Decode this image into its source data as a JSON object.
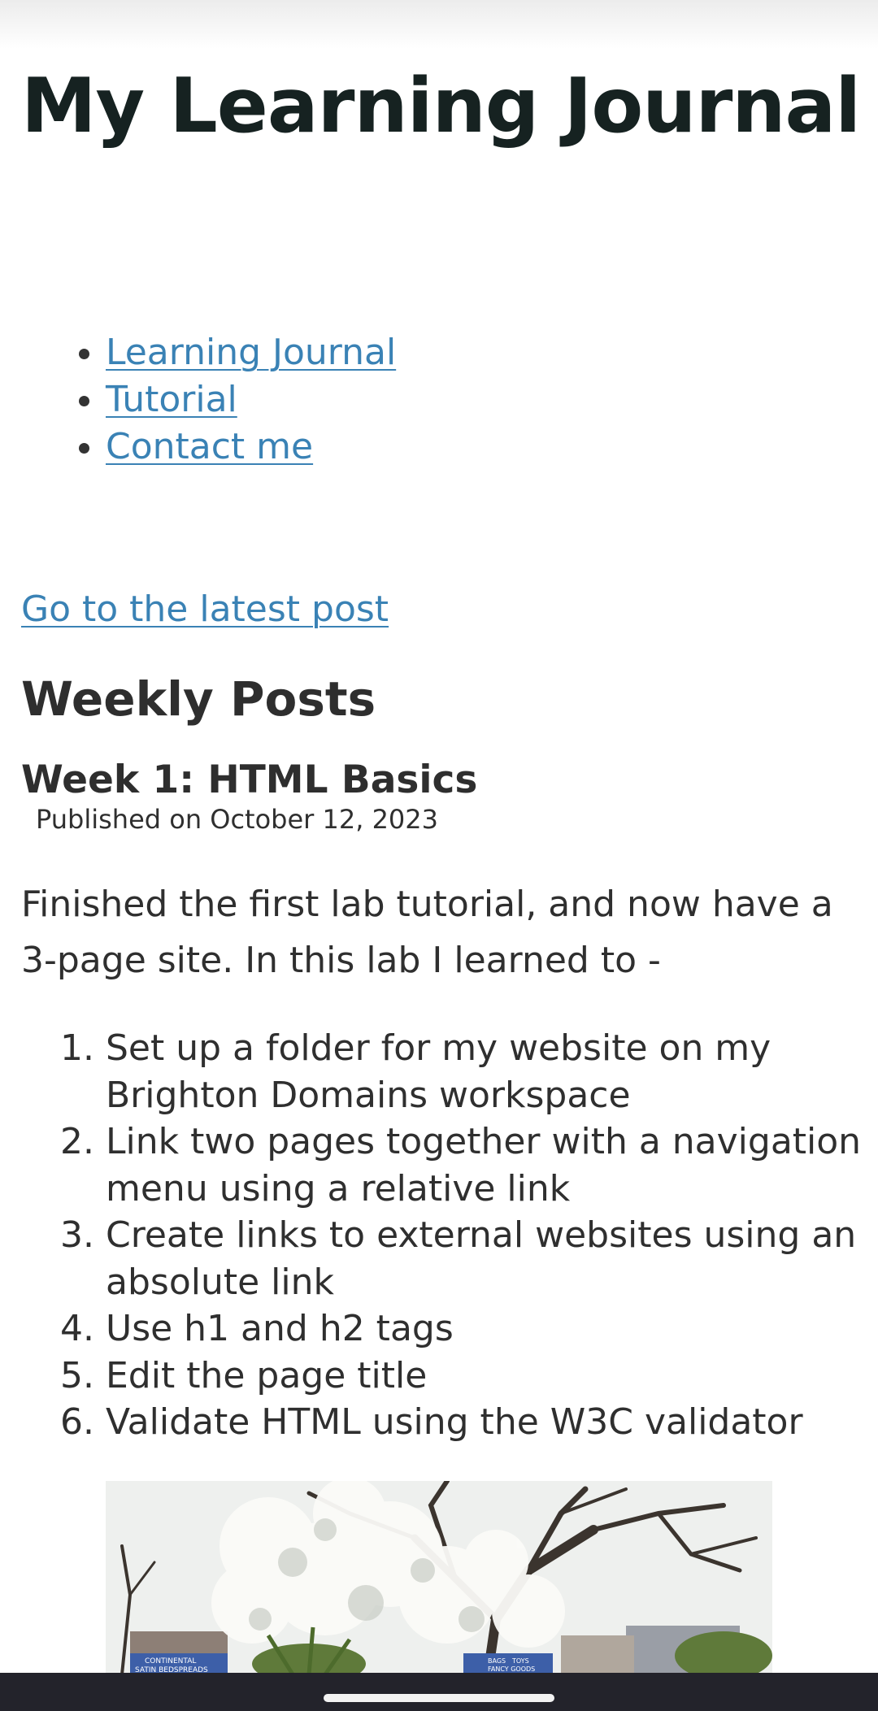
{
  "header": {
    "title": "My Learning Journal"
  },
  "nav": {
    "items": [
      {
        "label": "Learning Journal"
      },
      {
        "label": "Tutorial"
      },
      {
        "label": "Contact me"
      }
    ]
  },
  "main": {
    "latest_link": "Go to the latest post",
    "section_heading": "Weekly Posts",
    "post": {
      "title": "Week 1: HTML Basics",
      "date": "Published on October 12, 2023",
      "intro": "Finished the first lab tutorial, and now have a 3-page site. In this lab I learned to -",
      "learnings": [
        "Set up a folder for my website on my Brighton Domains workspace",
        "Link two pages together with a navigation menu using a relative link",
        "Create links to external websites using an absolute link",
        "Use h1 and h2 tags",
        "Edit the page title",
        "Validate HTML using the W3C validator"
      ],
      "photo_sign_text": [
        "CONTINENTAL",
        "SATIN BEDSPREADS",
        "BAGS",
        "TOYS",
        "FANCY GOODS"
      ]
    }
  },
  "colors": {
    "link": "#3a82b5",
    "title": "#162221",
    "text": "#2f2f2f",
    "system_bar": "#23232b"
  }
}
